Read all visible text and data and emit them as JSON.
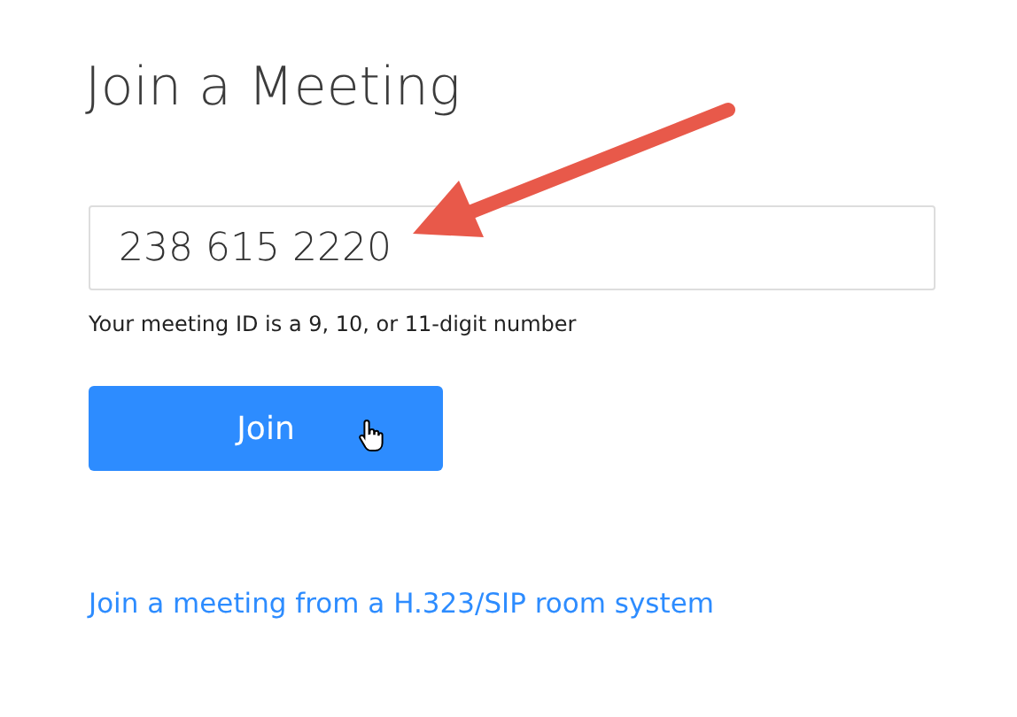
{
  "title": "Join a Meeting",
  "meeting_id": {
    "value": "238 615 2220"
  },
  "hint": "Your meeting ID is a 9, 10, or 11-digit number",
  "join_button": {
    "label": "Join"
  },
  "room_link": "Join a meeting from a H.323/SIP room system"
}
